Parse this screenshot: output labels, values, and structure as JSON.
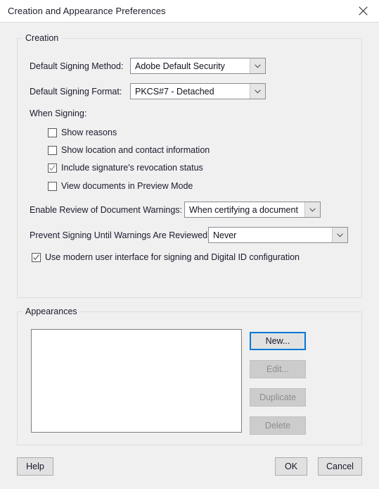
{
  "window": {
    "title": "Creation and Appearance Preferences",
    "close_icon": "close-icon"
  },
  "creation": {
    "legend": "Creation",
    "signing_method": {
      "label": "Default Signing Method:",
      "value": "Adobe Default Security"
    },
    "signing_format": {
      "label": "Default Signing Format:",
      "value": "PKCS#7 - Detached"
    },
    "when_signing_label": "When Signing:",
    "checkboxes": [
      {
        "label": "Show reasons",
        "checked": false
      },
      {
        "label": "Show location and contact information",
        "checked": false
      },
      {
        "label": "Include signature's revocation status",
        "checked": true
      },
      {
        "label": "View documents in Preview Mode",
        "checked": false
      }
    ],
    "review_warnings": {
      "label": "Enable Review of Document Warnings:",
      "value": "When certifying a document"
    },
    "prevent_signing": {
      "label": "Prevent Signing Until Warnings Are Reviewed:",
      "value": "Never"
    },
    "modern_ui": {
      "label": "Use modern user interface for signing and Digital ID configuration",
      "checked": true
    }
  },
  "appearances": {
    "legend": "Appearances",
    "items": [],
    "buttons": {
      "new": "New...",
      "edit": "Edit...",
      "duplicate": "Duplicate",
      "delete": "Delete"
    }
  },
  "footer": {
    "help": "Help",
    "ok": "OK",
    "cancel": "Cancel"
  },
  "colors": {
    "dialog_bg": "#f0f0f0",
    "titlebar_bg": "#ffffff",
    "focus_border": "#0078d7",
    "disabled_text": "#8d8d8d",
    "field_bg": "#ffffff"
  }
}
